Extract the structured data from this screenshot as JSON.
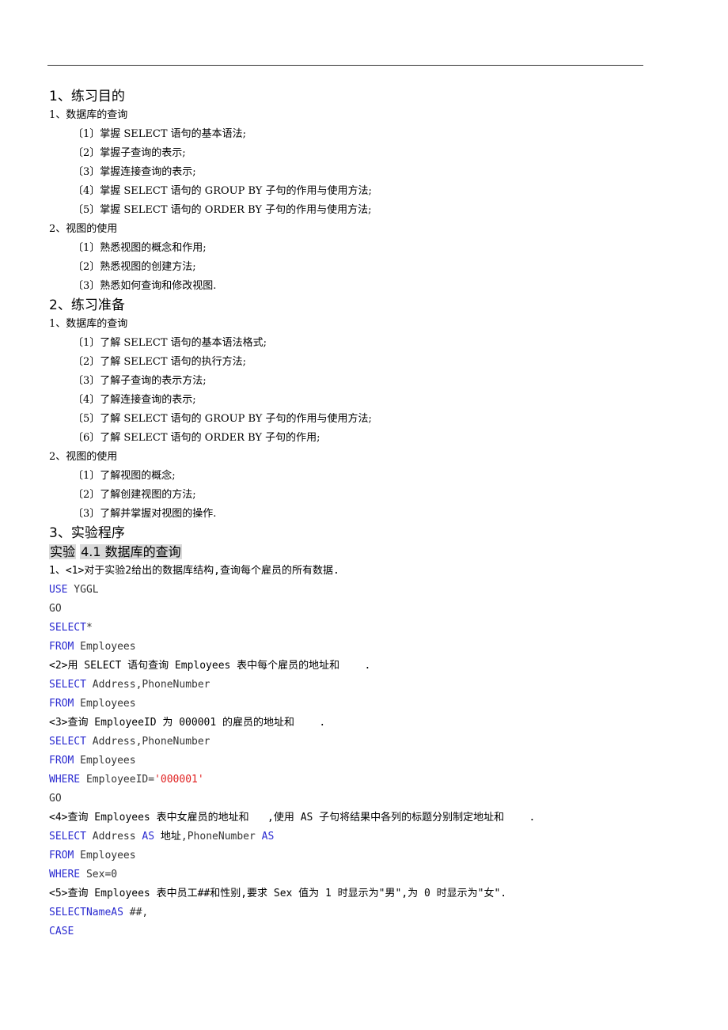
{
  "sections": [
    {
      "heading": "1、练习目的",
      "groups": [
        {
          "title": "1、数据库的查询",
          "items": [
            "〔1〕掌握 SELECT 语句的基本语法;",
            "〔2〕掌握子查询的表示;",
            "〔3〕掌握连接查询的表示;",
            "〔4〕掌握 SELECT 语句的 GROUP BY 子句的作用与使用方法;",
            "〔5〕掌握 SELECT 语句的 ORDER BY 子句的作用与使用方法;"
          ]
        },
        {
          "title": "2、视图的使用",
          "items": [
            "〔1〕熟悉视图的概念和作用;",
            "〔2〕熟悉视图的创建方法;",
            "〔3〕熟悉如何查询和修改视图."
          ]
        }
      ]
    },
    {
      "heading": "2、练习准备",
      "groups": [
        {
          "title": "1、数据库的查询",
          "items": [
            "〔1〕了解 SELECT 语句的基本语法格式;",
            "〔2〕了解 SELECT 语句的执行方法;",
            "〔3〕了解子查询的表示方法;",
            "〔4〕了解连接查询的表示;",
            "〔5〕了解 SELECT 语句的 GROUP BY 子句的作用与使用方法;",
            "〔6〕了解 SELECT 语句的 ORDER BY 子句的作用;"
          ]
        },
        {
          "title": "2、视图的使用",
          "items": [
            "〔1〕了解视图的概念;",
            "〔2〕了解创建视图的方法;",
            "〔3〕了解并掌握对视图的操作."
          ]
        }
      ]
    }
  ],
  "procedure": {
    "heading": "3、实验程序",
    "experiment_title_a": "实验",
    "experiment_title_b": "4.1 数据库的查询",
    "lines": [
      {
        "type": "text",
        "parts": [
          {
            "c": "tx",
            "t": "1、<1>对于实验2给出的数据库结构,查询每个雇员的所有数据."
          }
        ]
      },
      {
        "type": "code",
        "parts": [
          {
            "c": "kw",
            "t": "USE"
          },
          {
            "c": "",
            "t": " YGGL"
          }
        ]
      },
      {
        "type": "code",
        "parts": [
          {
            "c": "",
            "t": "GO"
          }
        ]
      },
      {
        "type": "code",
        "parts": [
          {
            "c": "kw",
            "t": "SELECT"
          },
          {
            "c": "",
            "t": "*"
          }
        ]
      },
      {
        "type": "code",
        "parts": [
          {
            "c": "kw",
            "t": "FROM"
          },
          {
            "c": "",
            "t": " Employees"
          }
        ]
      },
      {
        "type": "text",
        "parts": [
          {
            "c": "tx",
            "t": "<2>用 SELECT 语句查询 Employees 表中每个雇员的地址和    ."
          }
        ]
      },
      {
        "type": "code",
        "parts": [
          {
            "c": "kw",
            "t": "SELECT"
          },
          {
            "c": "",
            "t": " Address,PhoneNumber"
          }
        ]
      },
      {
        "type": "code",
        "parts": [
          {
            "c": "kw",
            "t": "FROM"
          },
          {
            "c": "",
            "t": " Employees"
          }
        ]
      },
      {
        "type": "text",
        "parts": [
          {
            "c": "tx",
            "t": "<3>查询 EmployeeID 为 000001 的雇员的地址和    ."
          }
        ]
      },
      {
        "type": "code",
        "parts": [
          {
            "c": "kw",
            "t": "SELECT"
          },
          {
            "c": "",
            "t": " Address,PhoneNumber"
          }
        ]
      },
      {
        "type": "code",
        "parts": [
          {
            "c": "kw",
            "t": "FROM"
          },
          {
            "c": "",
            "t": " Employees"
          }
        ]
      },
      {
        "type": "code",
        "parts": [
          {
            "c": "kw",
            "t": "WHERE"
          },
          {
            "c": "",
            "t": " EmployeeID="
          },
          {
            "c": "str",
            "t": "'000001'"
          }
        ]
      },
      {
        "type": "code",
        "parts": [
          {
            "c": "",
            "t": "GO"
          }
        ]
      },
      {
        "type": "text",
        "parts": [
          {
            "c": "tx",
            "t": "<4>查询 Employees 表中女雇员的地址和   ,使用 AS 子句将结果中各列的标题分别制定地址和    ."
          }
        ]
      },
      {
        "type": "code",
        "parts": [
          {
            "c": "kw",
            "t": "SELECT"
          },
          {
            "c": "",
            "t": " Address "
          },
          {
            "c": "kw",
            "t": "AS"
          },
          {
            "c": "tx",
            "t": " 地址"
          },
          {
            "c": "",
            "t": ",PhoneNumber "
          },
          {
            "c": "kw",
            "t": "AS"
          }
        ]
      },
      {
        "type": "code",
        "parts": [
          {
            "c": "kw",
            "t": "FROM"
          },
          {
            "c": "",
            "t": " Employees"
          }
        ]
      },
      {
        "type": "code",
        "parts": [
          {
            "c": "kw",
            "t": "WHERE"
          },
          {
            "c": "",
            "t": " Sex=0"
          }
        ]
      },
      {
        "type": "text",
        "parts": [
          {
            "c": "tx",
            "t": "<5>查询 Employees 表中员工##和性别,要求 Sex 值为 1 时显示为\"男\",为 0 时显示为\"女\"."
          }
        ]
      },
      {
        "type": "code",
        "parts": [
          {
            "c": "kw",
            "t": "SELECTNameAS"
          },
          {
            "c": "",
            "t": " ##,"
          }
        ]
      },
      {
        "type": "code",
        "parts": [
          {
            "c": "kw",
            "t": "CASE"
          }
        ]
      }
    ]
  }
}
